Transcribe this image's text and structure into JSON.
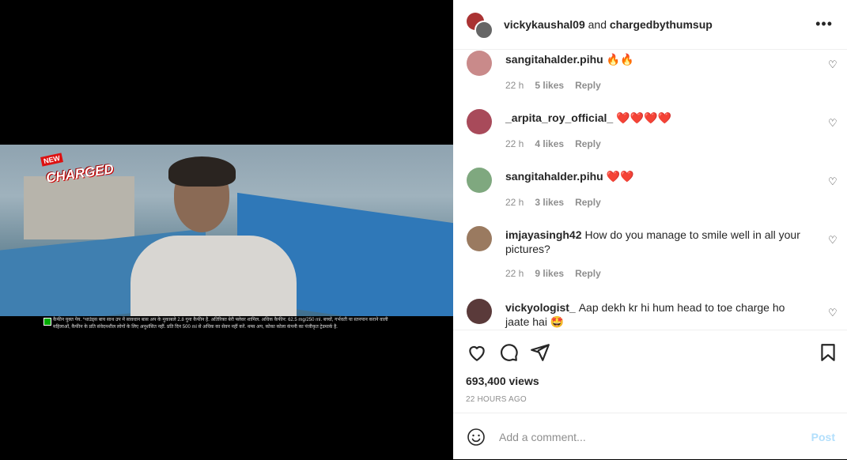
{
  "video": {
    "logo_new": "NEW",
    "logo_charged": "CHARGED",
    "disclaimer": "कैफीन युक्त पेय. *थाउंड्स बाय साथ उप में सावधान बास अप के मुकाबले 2.8 गुना कैफीन है. अतिरिक्त बेरी फ्लेवर शामिल. अधिक कैफीन: 62.5 mg/250 ml. बच्चों, गर्भवती या स्तनपान कराने वाली महिलाओं, कैफीन के प्रति संवेदनशील लोगों के लिए अनुशंसित नहीं. प्रति दिन 500 ml से अधिक का सेवन नहीं करें. थम्स अप, कोका कोला कंपनी का पंजीकृत ट्रेडमार्क है."
  },
  "header": {
    "user1": "vickykaushal09",
    "connector": " and ",
    "user2": "chargedbythumsup",
    "more_glyph": "•••"
  },
  "comments": [
    {
      "username": "sangitahalder.pihu",
      "text": "🔥🔥",
      "time": "22 h",
      "likes": "5 likes",
      "reply": "Reply",
      "avatar_color": "#c98a8a"
    },
    {
      "username": "_arpita_roy_official_",
      "text": "❤️❤️❤️❤️",
      "time": "22 h",
      "likes": "4 likes",
      "reply": "Reply",
      "avatar_color": "#a84a5a"
    },
    {
      "username": "sangitahalder.pihu",
      "text": "❤️❤️",
      "time": "22 h",
      "likes": "3 likes",
      "reply": "Reply",
      "avatar_color": "#7fa87f"
    },
    {
      "username": "imjayasingh42",
      "text": "How do you manage to smile well in all your pictures?",
      "time": "22 h",
      "likes": "9 likes",
      "reply": "Reply",
      "avatar_color": "#9a7a60"
    },
    {
      "username": "vickyologist_",
      "text": "Aap dekh kr hi hum head to toe charge ho jaate hai 🤩",
      "time": "",
      "likes": "",
      "reply": "",
      "avatar_color": "#5a3a3a"
    }
  ],
  "actions": {
    "views": "693,400 views",
    "posted": "22 HOURS AGO"
  },
  "add_comment": {
    "placeholder": "Add a comment...",
    "post_label": "Post"
  }
}
